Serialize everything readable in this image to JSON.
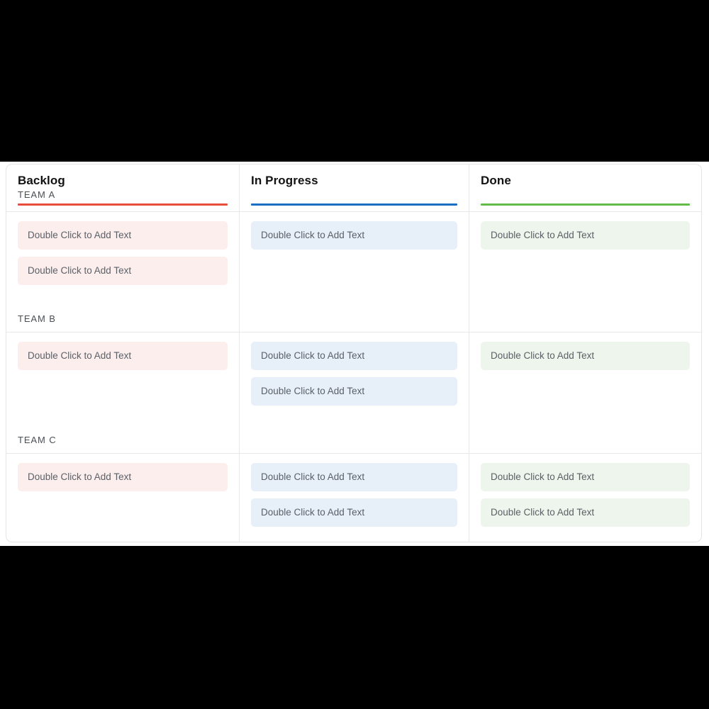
{
  "board": {
    "columns": [
      {
        "title": "Backlog",
        "accent_color": "#e74c3c",
        "card_color": "#fdeeee",
        "swatch": "red"
      },
      {
        "title": "In Progress",
        "accent_color": "#1a6fc4",
        "card_color": "#e7eff8",
        "swatch": "blue"
      },
      {
        "title": "Done",
        "accent_color": "#62bb46",
        "card_color": "#edf5ec",
        "swatch": "green"
      }
    ],
    "header_lane_label": "TEAM A",
    "card_placeholder": "Double Click to Add Text",
    "lanes": [
      {
        "trailing_label": "TEAM B",
        "cells": [
          {
            "cards": [
              "Double Click to Add Text",
              "Double Click to Add Text"
            ]
          },
          {
            "cards": [
              "Double Click to Add Text"
            ]
          },
          {
            "cards": [
              "Double Click to Add Text"
            ]
          }
        ]
      },
      {
        "trailing_label": "TEAM C",
        "cells": [
          {
            "cards": [
              "Double Click to Add Text"
            ]
          },
          {
            "cards": [
              "Double Click to Add Text",
              "Double Click to Add Text"
            ]
          },
          {
            "cards": [
              "Double Click to Add Text"
            ]
          }
        ]
      },
      {
        "trailing_label": "",
        "cells": [
          {
            "cards": [
              "Double Click to Add Text"
            ]
          },
          {
            "cards": [
              "Double Click to Add Text",
              "Double Click to Add Text"
            ]
          },
          {
            "cards": [
              "Double Click to Add Text",
              "Double Click to Add Text"
            ]
          }
        ]
      }
    ]
  }
}
